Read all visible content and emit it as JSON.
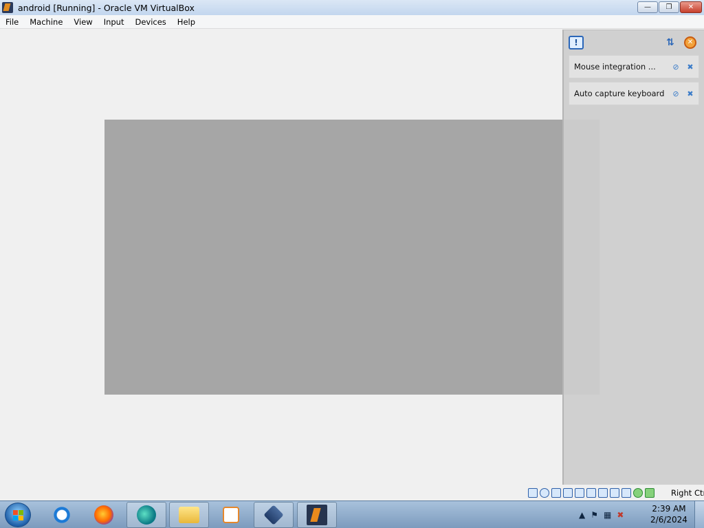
{
  "window": {
    "title": "android  [Running] - Oracle VM VirtualBox",
    "icon": "virtualbox-vm-icon",
    "minimize_glyph": "—",
    "restore_glyph": "❐",
    "close_glyph": "✕"
  },
  "menubar": {
    "items": [
      "File",
      "Machine",
      "View",
      "Input",
      "Devices",
      "Help"
    ]
  },
  "notification_center": {
    "bang_glyph": "!",
    "sort_glyph": "⇅",
    "clear_glyph": "✕",
    "items": [
      {
        "label": "Mouse integration ...",
        "icon_a": "⊘",
        "icon_b": "✖"
      },
      {
        "label": "Auto capture keyboard ...",
        "icon_a": "⊘",
        "icon_b": "✖"
      }
    ]
  },
  "statusbar": {
    "host_key": "Right Ctrl"
  },
  "taskbar": {
    "clock_time": "2:39 AM",
    "clock_date": "2/6/2024",
    "tray_up_glyph": "▲",
    "tray_flag_glyph": "⚑",
    "tray_network_glyph": "▦",
    "tray_volume_glyph": "✖"
  },
  "colors": {
    "vm_screen": "#a6a6a6",
    "titlebar": "#c2d6ee",
    "taskbar": "#7c9bbd"
  }
}
